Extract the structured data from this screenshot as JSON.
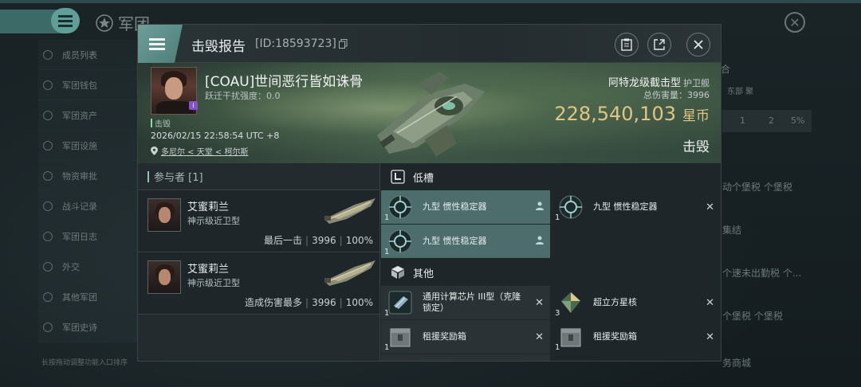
{
  "background": {
    "title": "军团",
    "sidebar_items": [
      "成员列表",
      "军团钱包",
      "军团资产",
      "军团设施",
      "物资审批",
      "战斗记录",
      "军团日志",
      "外交",
      "其他军团",
      "军团史诗"
    ],
    "footer_hint": "长按拖动调整功能入口排序",
    "right_texts": {
      "t1": "合",
      "t2": "东部 聚",
      "t3": "1",
      "t4": "2",
      "t5": "5%",
      "t6": "动个堡税 个堡税",
      "t7": "集结",
      "t8": "个速未出勤税 个...",
      "t9": "个堡税 个堡税",
      "t10": "务商城"
    }
  },
  "dialog": {
    "title": "击毁报告",
    "report_id": "[ID:18593723]",
    "victim": {
      "name": "[COAU]世间恶行皆如诛骨",
      "jamming": "跃迁干扰强度：0.0",
      "status": "击毁",
      "timestamp": "2026/02/15 22:58:54 UTC +8",
      "location": "多尼尔 < 天堂 < 柯尔斯"
    },
    "ship": {
      "name": "阿特龙级截击型",
      "class": "护卫舰",
      "damage_label": "总伤害量：3996",
      "value": "228,540,103",
      "value_unit": "星币",
      "result": "击毁"
    },
    "participants": {
      "header": "参与者 [1]",
      "rows": [
        {
          "name": "艾蜜莉兰",
          "ship": "神示级近卫型",
          "tag": "最后一击",
          "damage": "3996",
          "percent": "100%"
        },
        {
          "name": "艾蜜莉兰",
          "ship": "神示级近卫型",
          "tag": "造成伤害最多",
          "damage": "3996",
          "percent": "100%"
        }
      ]
    },
    "low_slot": {
      "title": "低槽",
      "modules": [
        {
          "qty": "1",
          "name": "九型 惯性稳定器",
          "selected": true,
          "action": "👤"
        },
        {
          "qty": "1",
          "name": "九型 惯性稳定器",
          "selected": false,
          "action": "✕"
        },
        {
          "qty": "1",
          "name": "九型 惯性稳定器",
          "selected": true,
          "action": "👤"
        }
      ]
    },
    "other": {
      "title": "其他",
      "items": [
        {
          "qty": "1",
          "name": "通用计算芯片 III型（克隆锁定）",
          "action": "✕"
        },
        {
          "qty": "3",
          "name": "超立方星核",
          "action": "✕"
        },
        {
          "qty": "1",
          "name": "租援奖励箱",
          "action": "✕"
        },
        {
          "qty": "1",
          "name": "租援奖励箱",
          "action": "✕"
        }
      ]
    }
  }
}
